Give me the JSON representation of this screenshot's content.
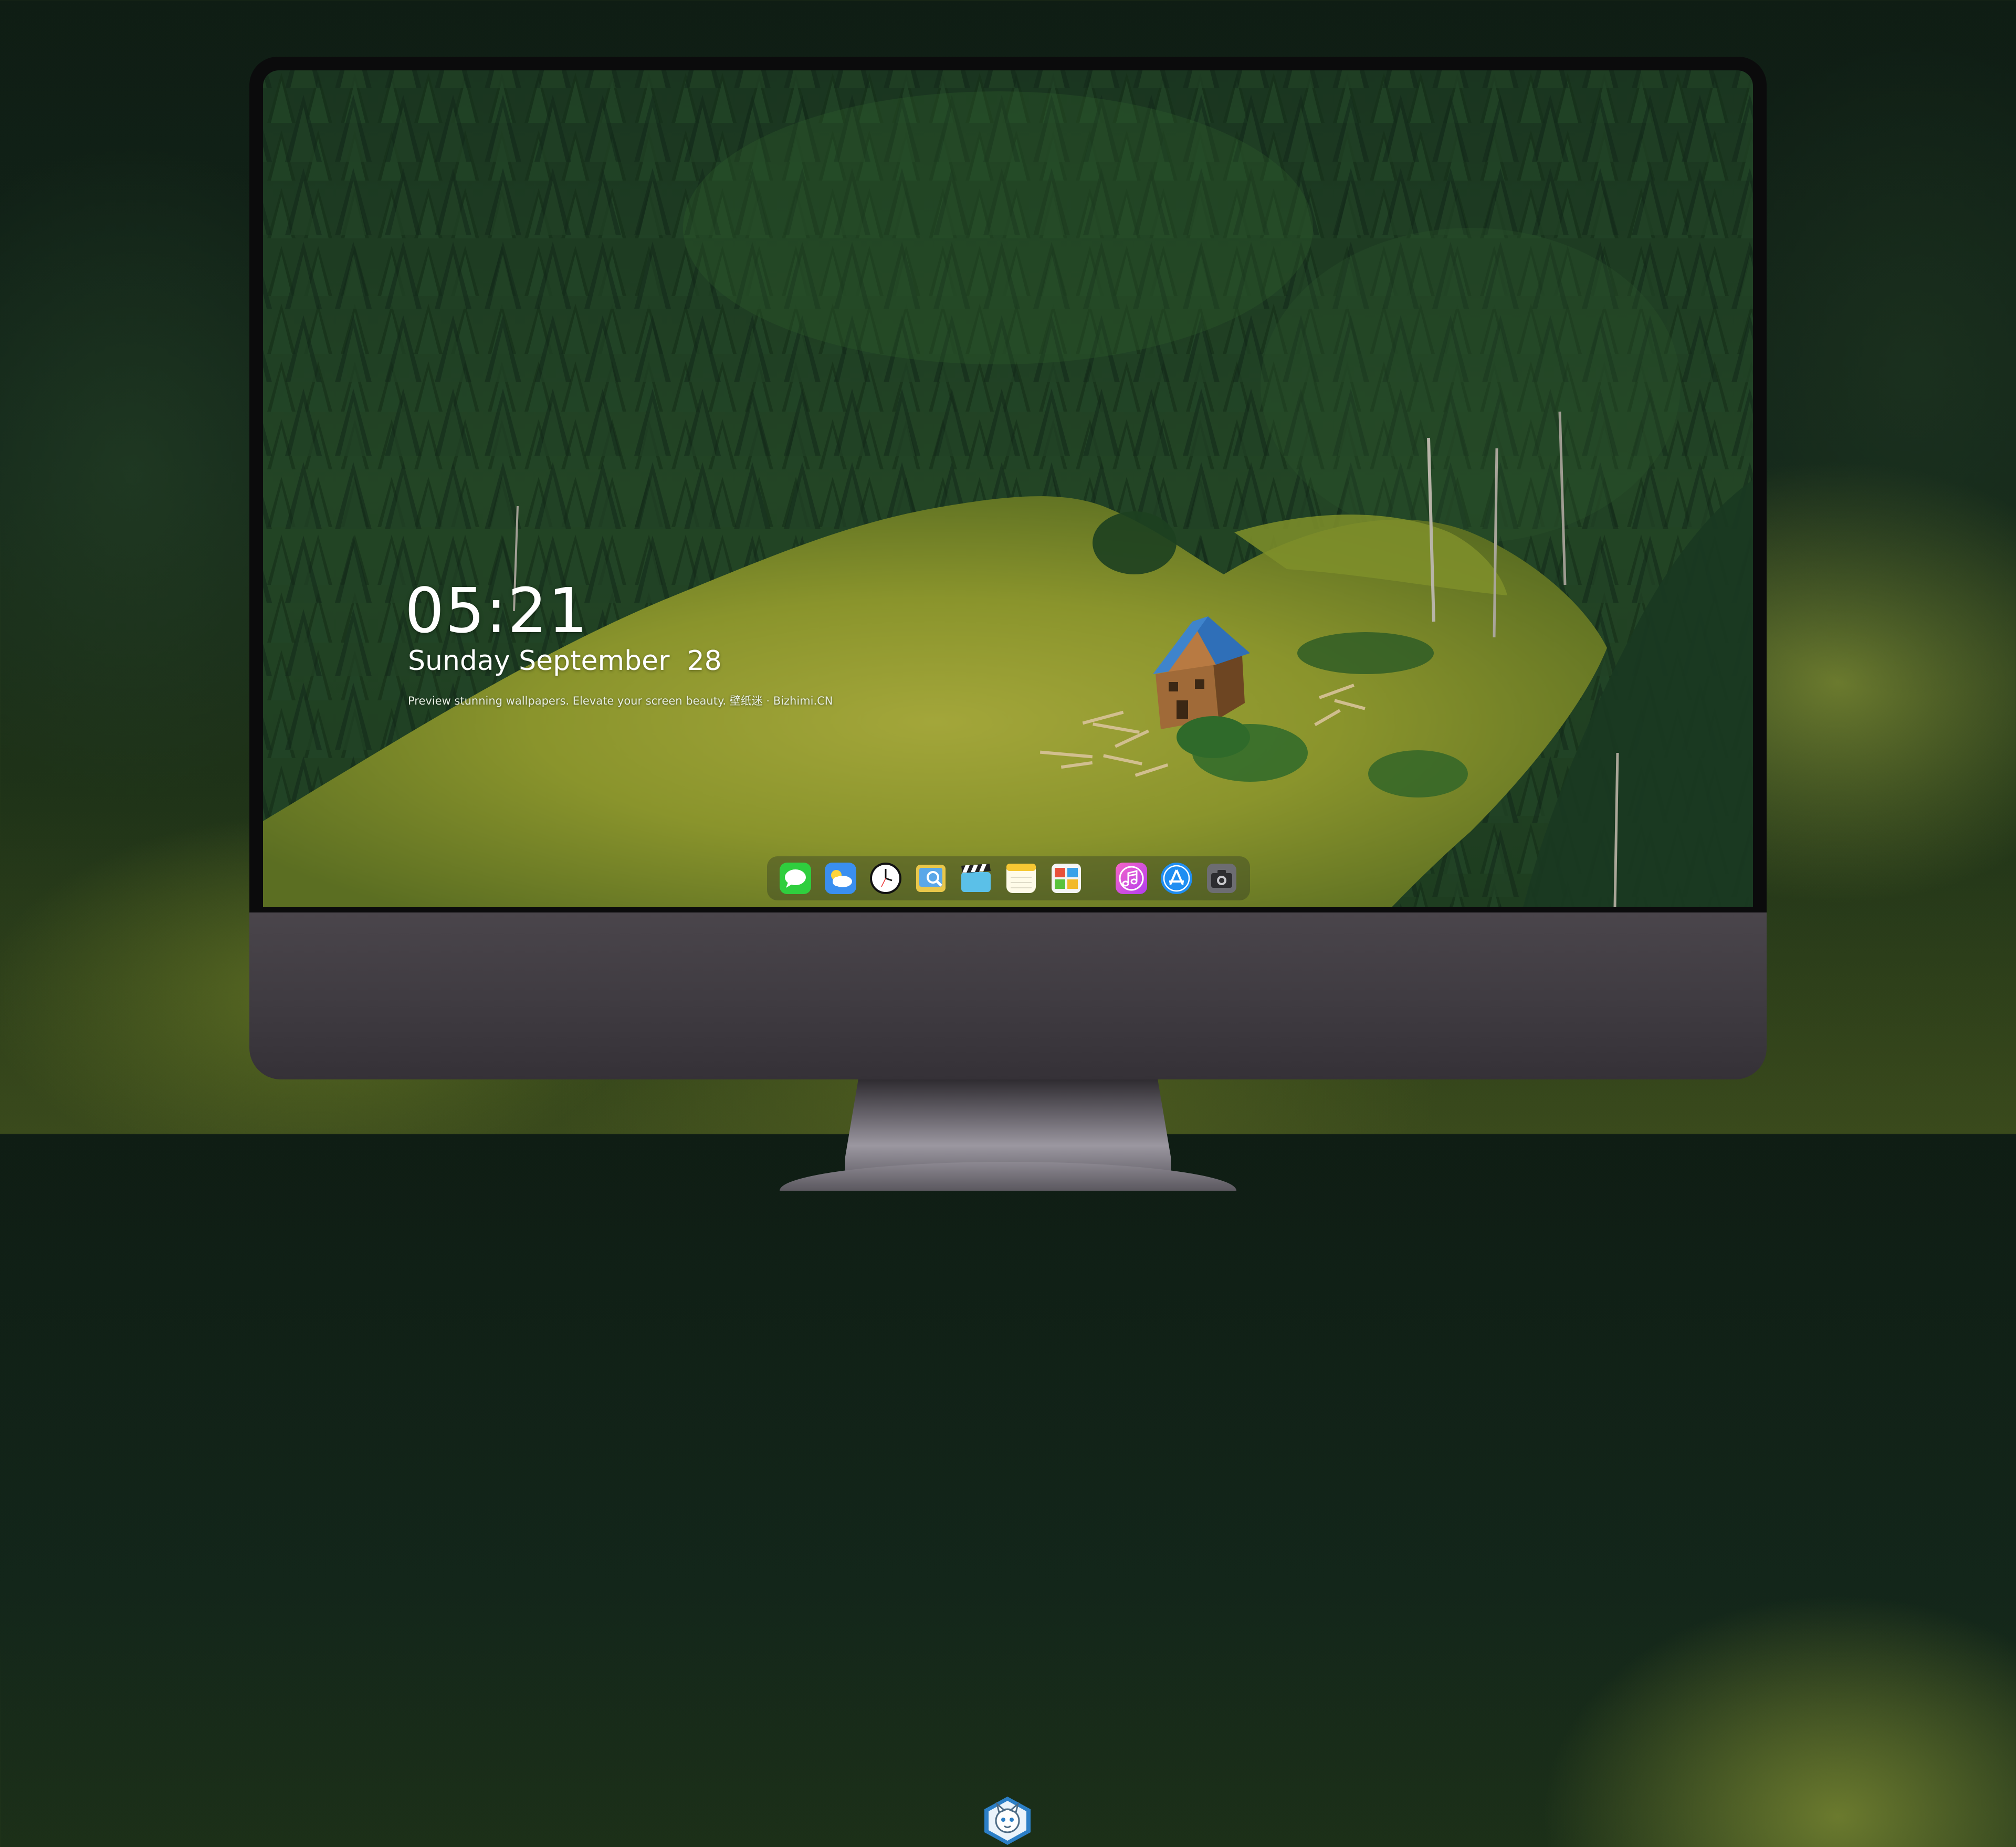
{
  "lock_screen": {
    "time": "05:21",
    "date": "Sunday September  28",
    "tagline": "Preview stunning wallpapers. Elevate your screen beauty. 壁纸迷 · Bizhimi.CN"
  },
  "dock": {
    "apps": [
      {
        "name": "Messages",
        "icon": "messages-icon"
      },
      {
        "name": "Weather",
        "icon": "weather-icon"
      },
      {
        "name": "Clock",
        "icon": "clock-icon"
      },
      {
        "name": "Preview",
        "icon": "preview-icon"
      },
      {
        "name": "Clips",
        "icon": "clips-icon"
      },
      {
        "name": "Notes",
        "icon": "notes-icon"
      },
      {
        "name": "Photo Booth",
        "icon": "photos-icon"
      },
      {
        "name": "iTunes",
        "icon": "music-icon"
      },
      {
        "name": "App Store",
        "icon": "app-store-icon"
      },
      {
        "name": "Camera",
        "icon": "camera-icon"
      }
    ]
  },
  "colors": {
    "forest_dark": "#1d3a22",
    "meadow": "#8a9a2e",
    "roof_blue": "#2f6fb8",
    "cabin_wood": "#a06a38",
    "monitor_chin": "#3e3a40"
  }
}
